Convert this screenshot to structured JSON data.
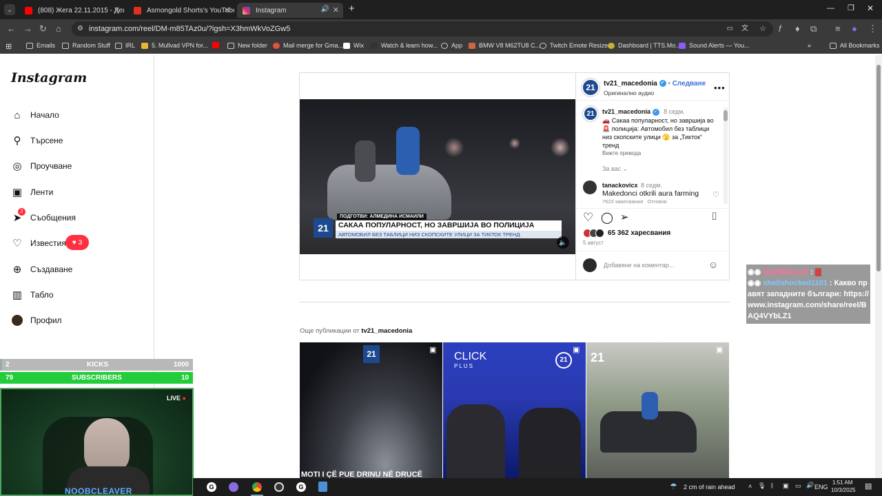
{
  "browser": {
    "tabs": [
      {
        "title": "(808) Жега 22.11.2015 - Децата...",
        "color": "#ff0000"
      },
      {
        "title": "Asmongold Shorts's YouTube S...",
        "color": "#e0301e"
      },
      {
        "title": "Instagram",
        "color": "#d62976"
      }
    ],
    "new_tab": "+",
    "url": "instagram.com/reel/DM-m85TAz0u/?igsh=X3hmWkVoZGw5",
    "bookmarks": [
      "Emails",
      "Random Stuff",
      "IRL",
      "5. Mullvad VPN for...",
      "New folder",
      "Mail merge for Gma...",
      "Wix",
      "Watch & learn how...",
      "App",
      "BMW V8 M62TU8 C...",
      "Twitch Emote Resizer",
      "Dashboard | TTS.Mo...",
      "Sound Alerts — You..."
    ],
    "all_bookmarks": "All Bookmarks"
  },
  "instagram": {
    "logo": "Instagram",
    "nav": [
      {
        "label": "Начало",
        "icon": "home-icon"
      },
      {
        "label": "Търсене",
        "icon": "search-icon"
      },
      {
        "label": "Проучване",
        "icon": "compass-icon"
      },
      {
        "label": "Ленти",
        "icon": "reels-icon"
      },
      {
        "label": "Съобщения",
        "icon": "messenger-icon"
      },
      {
        "label": "Известия",
        "icon": "heart-icon"
      },
      {
        "label": "Създаване",
        "icon": "plus-square-icon"
      },
      {
        "label": "Табло",
        "icon": "dashboard-icon"
      },
      {
        "label": "Профил",
        "icon": "profile-avatar-icon"
      }
    ],
    "messages_badge": "2",
    "notifications_badge": "3"
  },
  "post": {
    "account": "tv21_macedonia",
    "follow": "Следване",
    "audio": "Оригинално аудио",
    "avatar_text": "21",
    "caption_time": "8 седм.",
    "caption": "🚗 Сакаа популарност, но завршија во 🚨 полиција: Автомобил без таблици низ скопските улици 🫣 за „Тикток“ тренд",
    "see_translation": "Вижте превода",
    "for_you": "За вас",
    "comment_user": "tanackovicx",
    "comment_time": "8 седм.",
    "comment_text": "Makedonci otkrili aura farming",
    "comment_meta": "7623 харесвания   Отговор",
    "likes": "65 362 харесвания",
    "date": "5 август",
    "add_comment_placeholder": "Добавяне на коментар...",
    "video_credit": "ПОДГОТВИ: АЛМЕДИНА ИСМАИЛИ",
    "video_headline": "САКАА ПОПУЛАРНОСТ, НО ЗАВРШИЈА ВО ПОЛИЦИЈА",
    "video_subline": "АВТОМОБИЛ БЕЗ ТАБЛИЦИ НИЗ СКОПСКИТЕ УЛИЦИ ЗА ТИКТОК ТРЕНД",
    "video_logo": "21"
  },
  "more": {
    "label": "Още публикации от",
    "account": "tv21_macedonia",
    "thumb1_caption": "MOTI I ÇË PUE DRINU NË DRUCË",
    "thumb2_title": "CLICK",
    "thumb2_sub": "PLUS"
  },
  "overlay": {
    "chat": [
      {
        "user": "NightMary25",
        "text": ":"
      },
      {
        "user": "shellshocked1101",
        "text": ": Какво правят западните българи: https://www.instagram.com/share/reel/BAQ4VYbLZ1"
      }
    ],
    "kicks_current": "2",
    "kicks_label": "KICKS",
    "kicks_goal": "1000",
    "kicks_progress": 0.002,
    "subs_current": "79",
    "subs_label": "SUBSCRIBERS",
    "subs_goal": "10",
    "subs_progress": 1.0,
    "live": "LIVE",
    "streamer": "NOOBCLEAVER"
  },
  "taskbar": {
    "weather": "2 cm of rain ahead",
    "lang": "ENG",
    "time": "1:51 AM",
    "date": "10/3/2025"
  }
}
